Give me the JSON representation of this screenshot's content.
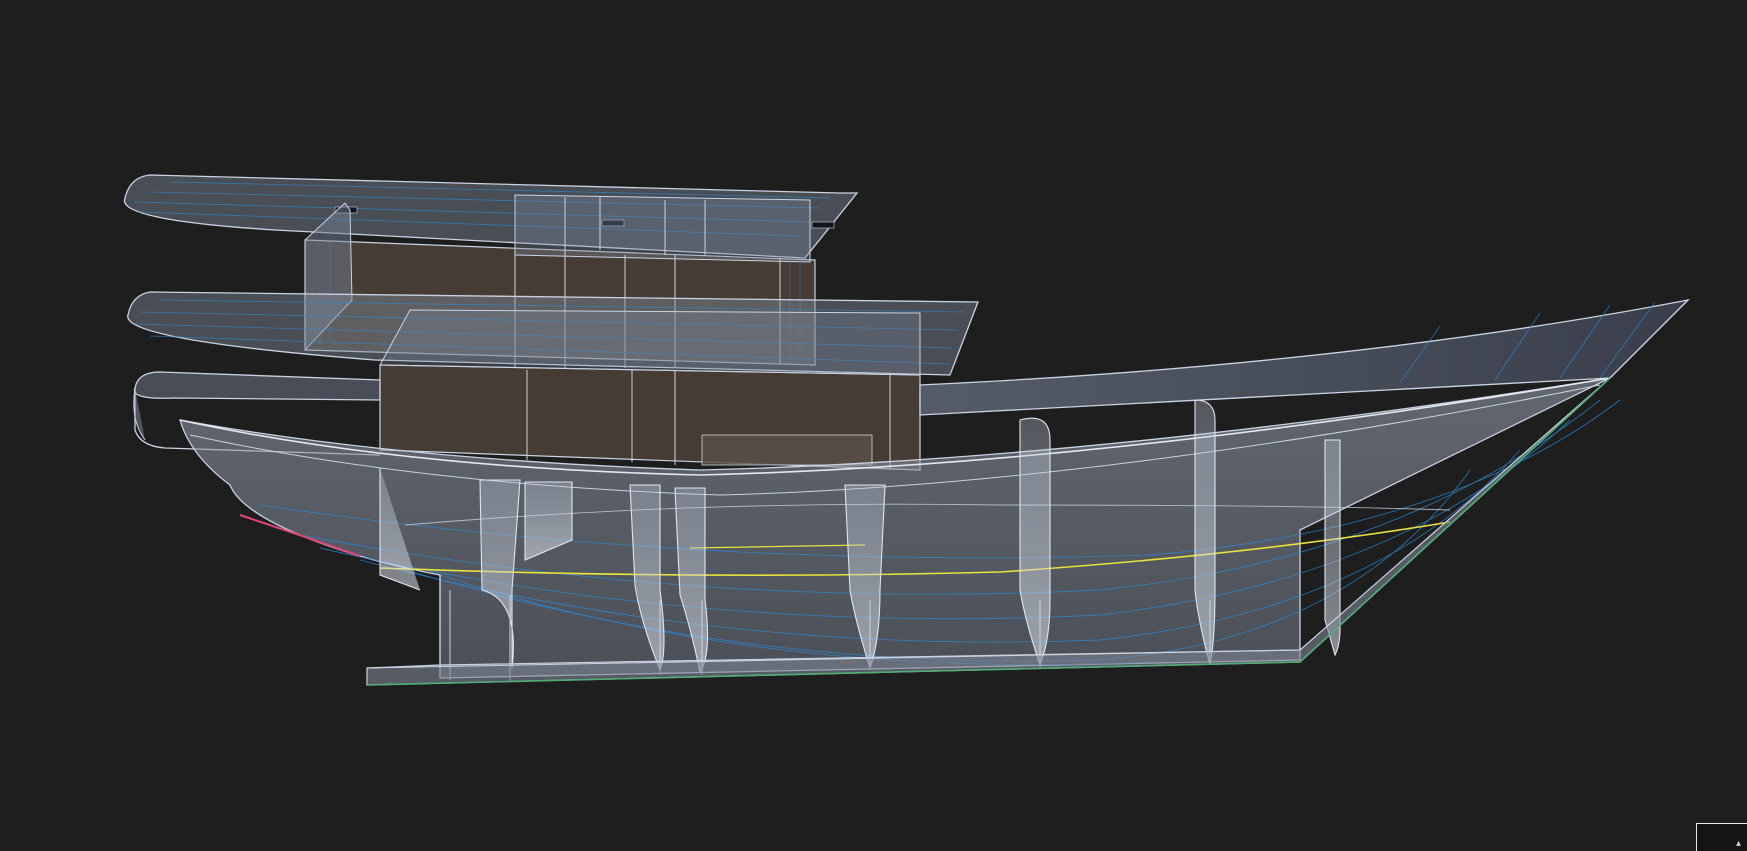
{
  "viewport": {
    "background": "#1e1e1e",
    "render_mode": "ghosted-wireframe",
    "model": "motor-yacht-hull-with-superstructure"
  },
  "colors": {
    "edge": "#c9d3e3",
    "hull_fill": "#8d97a8",
    "cabin_fill": "#4a3f35",
    "waterline": "#e8e23a",
    "isoparm": "#2b8bd6",
    "keel_line": "#4fae78",
    "bow_accent": "#e0457a"
  },
  "corner_widget": {
    "icon": "triangle-icon",
    "glyph": "▴"
  }
}
